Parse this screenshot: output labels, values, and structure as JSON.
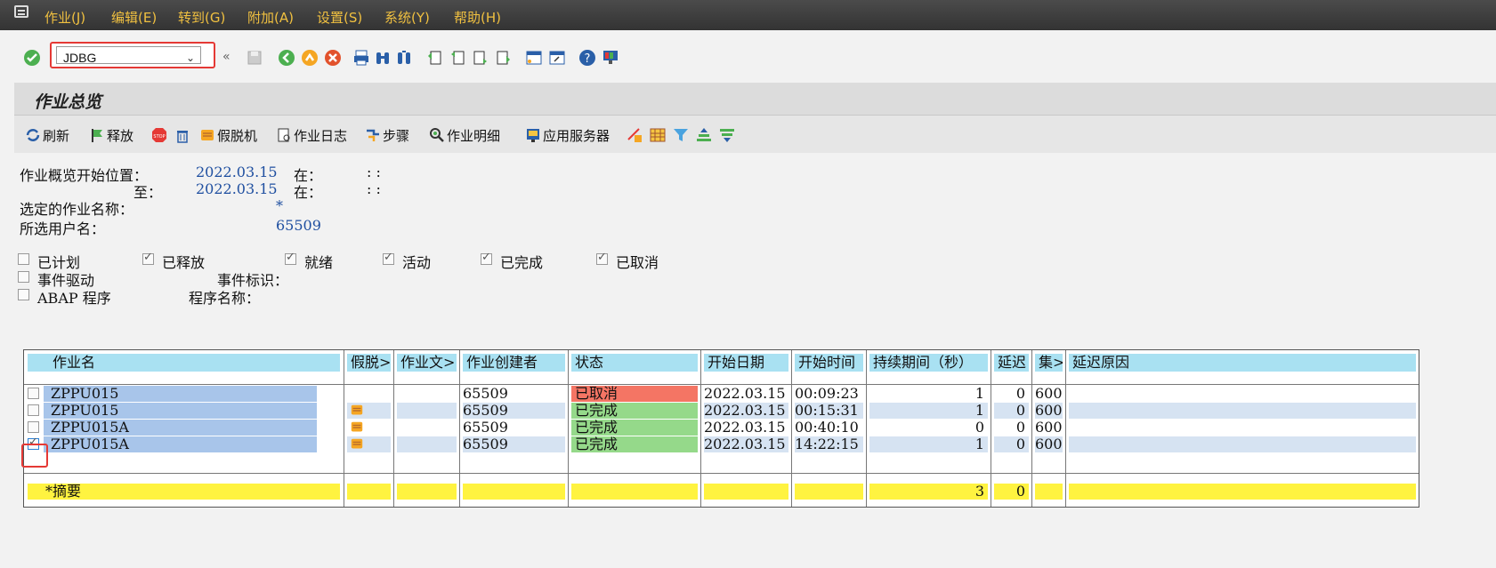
{
  "menu": {
    "items": [
      "作业(J)",
      "编辑(E)",
      "转到(G)",
      "附加(A)",
      "设置(S)",
      "系统(Y)",
      "帮助(H)"
    ]
  },
  "toolbar": {
    "command_value": "JDBG"
  },
  "page": {
    "title": "作业总览"
  },
  "app_toolbar": {
    "refresh": "刷新",
    "release": "释放",
    "debug": "假脱机",
    "job_log": "作业日志",
    "steps": "步骤",
    "job_detail": "作业明细",
    "app_server": "应用服务器"
  },
  "criteria": {
    "start_label": "作业概览开始位置：",
    "start_date": "2022.03.15",
    "at1": "在：",
    "time1": ":    :",
    "to_label": "至：",
    "to_date": "2022.03.15",
    "at2": "在：",
    "time2": ":    :",
    "jobname_label": "选定的作业名称：",
    "jobname_value": "*",
    "user_label": "所选用户名：",
    "user_value": "65509"
  },
  "status_filters": [
    {
      "label": "已计划",
      "checked": false
    },
    {
      "label": "已释放",
      "checked": true
    },
    {
      "label": "就绪",
      "checked": true
    },
    {
      "label": "活动",
      "checked": true
    },
    {
      "label": "已完成",
      "checked": true
    },
    {
      "label": "已取消",
      "checked": true
    }
  ],
  "event": {
    "label": "事件驱动",
    "checked": false,
    "id_label": "事件标识："
  },
  "abap": {
    "label": "ABAP 程序",
    "checked": false,
    "prog_label": "程序名称："
  },
  "table": {
    "headers": [
      "作业名",
      "假脱>",
      "作业文>",
      "作业创建者",
      "状态",
      "开始日期",
      "开始时间",
      "持续期间（秒）",
      "延迟",
      "集>",
      "延迟原因"
    ],
    "rows": [
      {
        "name": "ZPPU015",
        "spool": false,
        "creator": "65509",
        "status": "已取消",
        "status_color": "#f47564",
        "date": "2022.03.15",
        "time": "00:09:23",
        "duration": "1",
        "delay": "0",
        "cls": "600",
        "checked": false
      },
      {
        "name": "ZPPU015",
        "spool": true,
        "creator": "65509",
        "status": "已完成",
        "status_color": "#95d98a",
        "date": "2022.03.15",
        "time": "00:15:31",
        "duration": "1",
        "delay": "0",
        "cls": "600",
        "checked": false
      },
      {
        "name": "ZPPU015A",
        "spool": true,
        "creator": "65509",
        "status": "已完成",
        "status_color": "#95d98a",
        "date": "2022.03.15",
        "time": "00:40:10",
        "duration": "0",
        "delay": "0",
        "cls": "600",
        "checked": false
      },
      {
        "name": "ZPPU015A",
        "spool": true,
        "creator": "65509",
        "status": "已完成",
        "status_color": "#95d98a",
        "date": "2022.03.15",
        "time": "14:22:15",
        "duration": "1",
        "delay": "0",
        "cls": "600",
        "checked": true
      }
    ],
    "summary": {
      "label": "*摘要",
      "duration": "3",
      "delay": "0"
    }
  }
}
